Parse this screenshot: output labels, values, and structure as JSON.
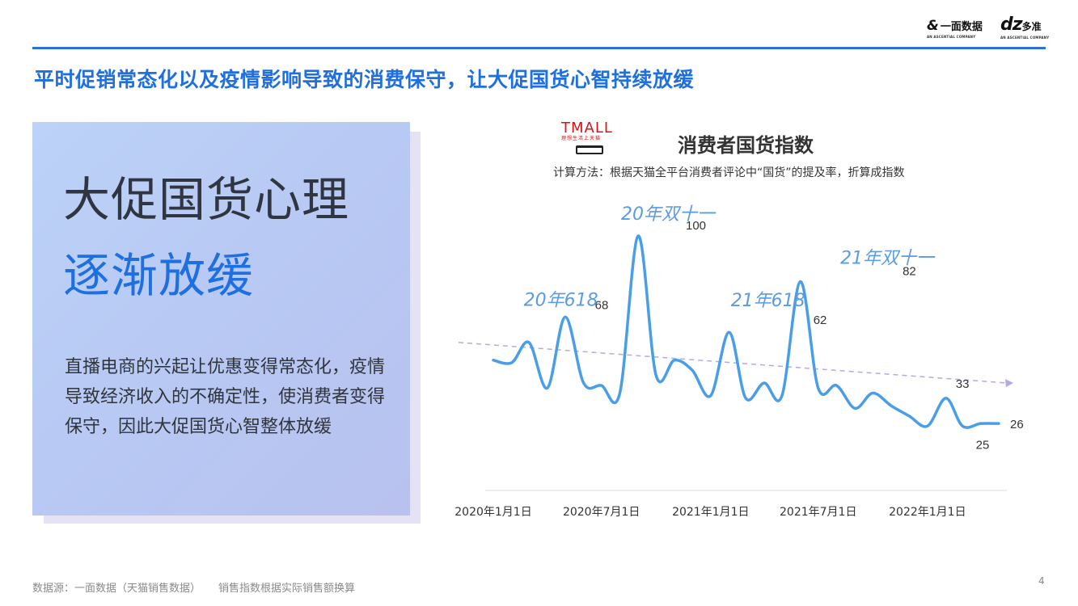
{
  "brand": {
    "yimian_mark": "&",
    "yimian_name": "一面数据",
    "yimian_sub": "AN ASCENTIAL COMPANY",
    "dz_mark": "dz",
    "dz_name": "多准",
    "dz_sub": "AN ASCENTIAL COMPANY"
  },
  "headline": "平时促销常态化以及疫情影响导致的消费保守，让大促国货心智持续放缓",
  "panel": {
    "title_line1": "大促国货心理",
    "title_line2": "逐渐放缓",
    "body": "直播电商的兴起让优惠变得常态化，疫情导致经济收入的不确定性，使消费者变得保守，因此大促国货心智整体放缓"
  },
  "chart_logo": {
    "name": "TMALL",
    "tagline": "理想生活上天猫"
  },
  "colors": {
    "accent": "#1f6fe0",
    "line": "#4a9ee8",
    "trend": "#b3a9e6",
    "event_label": "#5a9be4"
  },
  "chart_data": {
    "type": "line",
    "title": "消费者国货指数",
    "subtitle": "计算方法：根据天猫全平台消费者评论中“国货”的提及率，折算成指数",
    "xlabel": "",
    "ylabel": "",
    "x_ticks": [
      "2020年1月1日",
      "2020年7月1日",
      "2021年1月1日",
      "2021年7月1日",
      "2022年1月1日"
    ],
    "grid": false,
    "series": [
      {
        "x": [
          "2020-01-01",
          "2020-02-01",
          "2020-03-01",
          "2020-04-01",
          "2020-05-01",
          "2020-06-01",
          "2020-07-01",
          "2020-08-01",
          "2020-09-01",
          "2020-10-01",
          "2020-11-01",
          "2020-12-01",
          "2021-01-01",
          "2021-02-01",
          "2021-03-01",
          "2021-04-01",
          "2021-05-01",
          "2021-06-01",
          "2021-07-01",
          "2021-08-01",
          "2021-09-01",
          "2021-10-01",
          "2021-11-01",
          "2021-12-01",
          "2022-01-01",
          "2022-02-01",
          "2022-03-01",
          "2022-04-01",
          "2022-05-01"
        ],
        "values": [
          51,
          50,
          58,
          40,
          68,
          42,
          41,
          38,
          100,
          45,
          51,
          47,
          37,
          62,
          36,
          42,
          37,
          82,
          40,
          41,
          32,
          38,
          33,
          29,
          25,
          36,
          25,
          26,
          26
        ]
      }
    ],
    "point_labels": [
      {
        "x": "2020-06-01",
        "y": 68,
        "text": "68"
      },
      {
        "x": "2020-11-01",
        "y": 100,
        "text": "100"
      },
      {
        "x": "2021-06-01",
        "y": 62,
        "text": "62"
      },
      {
        "x": "2021-11-01",
        "y": 82,
        "text": "82"
      },
      {
        "x": "2022-03-01",
        "y": 33,
        "text": "33"
      },
      {
        "x": "2022-04-01",
        "y": 25,
        "text": "25"
      },
      {
        "x": "2022-05-01",
        "y": 26,
        "text": "26"
      }
    ],
    "annotations": [
      "20年618",
      "20年双十一",
      "21年618",
      "21年双十一"
    ],
    "trend_line": {
      "start": 58,
      "end": 42
    }
  },
  "footer": {
    "source": "数据源：一面数据（天猫销售数据）",
    "note": "销售指数根据实际销售额换算"
  },
  "page_number": "4"
}
